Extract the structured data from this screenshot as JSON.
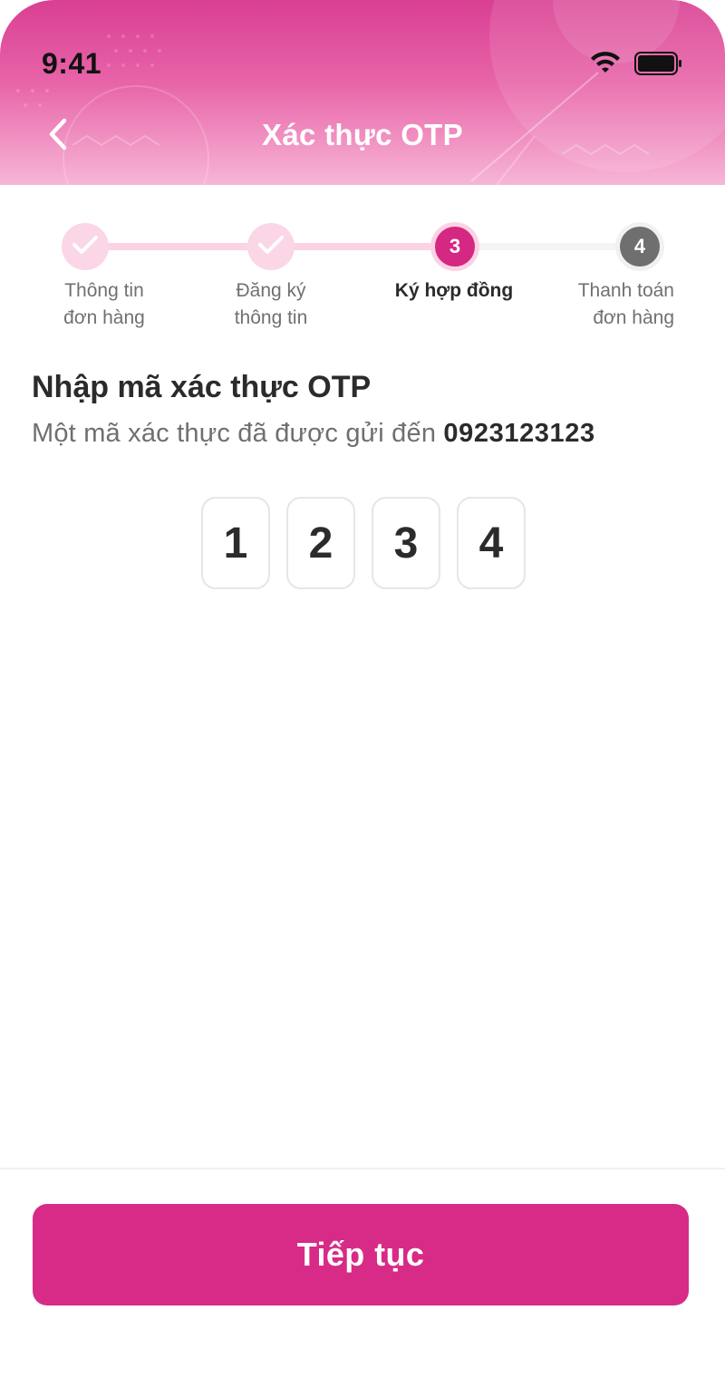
{
  "status_bar": {
    "time": "9:41"
  },
  "header": {
    "title": "Xác thực OTP"
  },
  "stepper": {
    "steps": [
      {
        "label_line1": "Thông tin",
        "label_line2": "đơn hàng",
        "state": "done"
      },
      {
        "label_line1": "Đăng ký",
        "label_line2": "thông tin",
        "state": "done"
      },
      {
        "number": "3",
        "label_line1": "Ký hợp đồng",
        "label_line2": "",
        "state": "active"
      },
      {
        "number": "4",
        "label_line1": "Thanh toán",
        "label_line2": "đơn hàng",
        "state": "todo"
      }
    ]
  },
  "otp": {
    "title": "Nhập mã xác thực OTP",
    "description": "Một mã xác thực đã được gửi đến",
    "phone": "0923123123",
    "digits": [
      "1",
      "2",
      "3",
      "4"
    ]
  },
  "footer": {
    "continue_label": "Tiếp tục"
  },
  "colors": {
    "primary": "#d72b87",
    "step_done_bg": "#fbd6e7",
    "step_todo_bg": "#6f6f70"
  },
  "icons": {
    "back": "chevron-left-icon",
    "check": "check-icon",
    "wifi": "wifi-icon",
    "battery": "battery-icon"
  }
}
